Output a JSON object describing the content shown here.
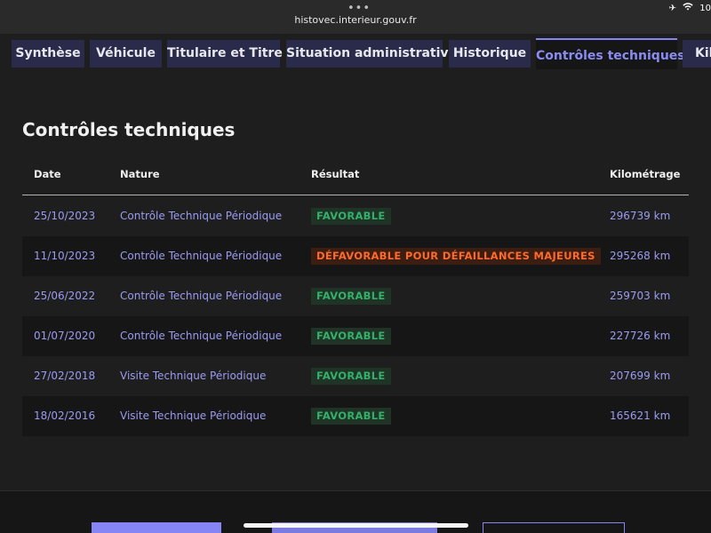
{
  "browser": {
    "dots": "•••",
    "url": "histovec.interieur.gouv.fr",
    "status_right": {
      "airplane": "✈",
      "wifi": "WiFi",
      "battery": "10"
    }
  },
  "tabs": [
    {
      "label": "Synthèse",
      "active": false
    },
    {
      "label": "Véhicule",
      "active": false
    },
    {
      "label": "Titulaire et Titre",
      "active": false
    },
    {
      "label": "Situation administrative",
      "active": false
    },
    {
      "label": "Historique",
      "active": false
    },
    {
      "label": "Contrôles techniques",
      "active": true
    },
    {
      "label": "Kil",
      "active": false
    }
  ],
  "section": {
    "title": "Contrôles techniques",
    "columns": {
      "date": "Date",
      "nature": "Nature",
      "result": "Résultat",
      "km": "Kilométrage"
    },
    "rows": [
      {
        "date": "25/10/2023",
        "nature": "Contrôle Technique Périodique",
        "result": "FAVORABLE",
        "status": "ok",
        "km": "296739 km"
      },
      {
        "date": "11/10/2023",
        "nature": "Contrôle Technique Périodique",
        "result": "DÉFAVORABLE POUR DÉFAILLANCES MAJEURES",
        "status": "ko",
        "km": "295268 km"
      },
      {
        "date": "25/06/2022",
        "nature": "Contrôle Technique Périodique",
        "result": "FAVORABLE",
        "status": "ok",
        "km": "259703 km"
      },
      {
        "date": "01/07/2020",
        "nature": "Contrôle Technique Périodique",
        "result": "FAVORABLE",
        "status": "ok",
        "km": "227726 km"
      },
      {
        "date": "27/02/2018",
        "nature": "Visite Technique Périodique",
        "result": "FAVORABLE",
        "status": "ok",
        "km": "207699 km"
      },
      {
        "date": "18/02/2016",
        "nature": "Visite Technique Périodique",
        "result": "FAVORABLE",
        "status": "ok",
        "km": "165621 km"
      }
    ]
  },
  "colors": {
    "accent": "#8585f6",
    "favorable_text": "#34b06a",
    "defavorable_text": "#ff6a2a"
  }
}
